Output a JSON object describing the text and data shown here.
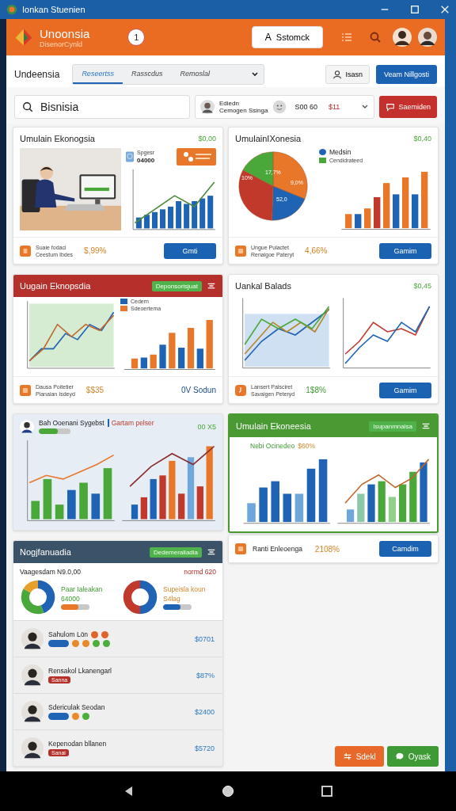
{
  "window": {
    "title": "Ionkan Stuenien"
  },
  "header": {
    "brand": "Unoonsia",
    "subtitle": "DisenorCynld",
    "badge": "1",
    "action": {
      "icon_text": "A",
      "label": "Sstomck"
    }
  },
  "nav": {
    "label": "Undeensia",
    "tabs": [
      {
        "label": "Reseertss",
        "selected": true
      },
      {
        "label": "Rasscdus",
        "selected": false
      },
      {
        "label": "Remoslal",
        "selected": false
      }
    ],
    "user_button": "Isasn",
    "primary_button": "Veam Nillgosti"
  },
  "search": {
    "value": "Bisnisia"
  },
  "account": {
    "name": "Ediedn",
    "subtitle": "Cemogen Ssinga",
    "amount": "S00 60",
    "change": "$11"
  },
  "alert_button": "Saemiden",
  "card_photo": {
    "title": "Umulain Ekonogsia",
    "value": "$0,00",
    "stat_label": "Spgesr",
    "stat_value": "04000",
    "footer_line1": "Suaie fodaci",
    "footer_line2": "Ceestum Ibdes",
    "footer_value": "$,99%",
    "button": "Gmti"
  },
  "card_pie": {
    "title": "UmulainIXonesia",
    "value": "$0,40",
    "slice_labels": [
      "17,7%",
      "10%",
      "9,0%",
      "52,0"
    ],
    "legend": [
      "Medsin",
      "Cendidrateed"
    ],
    "footer_line1": "Ungue Pulactet",
    "footer_line2": "Renaigoe Pateryt",
    "footer_value": "4,66%",
    "button": "Gamim"
  },
  "card_trend": {
    "title": "Uugain Eknopsdia",
    "badge": "Deponsorisjuat",
    "legend": [
      "Cedern",
      "Sdeoertema"
    ],
    "footer_line1": "Dausa Poitetier",
    "footer_line2": "Pianaian Isdeyd",
    "footer_value": "$$35",
    "link": "0V Sodun"
  },
  "card_balance": {
    "title": "Uankal Balads",
    "value": "$0,45",
    "footer_line1": "Lansert Palsciret",
    "footer_line2": "Savaigen Peteryd",
    "footer_value": "1$8%",
    "button": "Gamim"
  },
  "card_combo": {
    "name": "Bah Ooenani Sygebst",
    "tag": "Gartam pelser",
    "value": "00 X5",
    "level": 0.6
  },
  "card_growth": {
    "title": "Umulain Ekoneesia",
    "badge": "Isupanmnalsa",
    "metric_label": "Nebi Ocinedeo",
    "metric_value": "$60%"
  },
  "growth_footer": {
    "label": "Ranti Enleoenga",
    "value": "2108%",
    "button": "Camdim"
  },
  "card_team": {
    "title": "Nogjfanuadia",
    "badge": "Dedemeraliadia",
    "left_label": "Vaagesdam N9.0,00",
    "right_label": "normd 620",
    "donuts": [
      {
        "label": "Paar Ialeakan",
        "value": "64000",
        "level": 0.6
      },
      {
        "label": "Supeisla koun",
        "value": "S4lag",
        "level": 0.6
      }
    ],
    "people": [
      {
        "name": "Sahulom Lön",
        "name_dots": [
          {
            "color": "#e0632a"
          },
          {
            "color": "#e0632a"
          }
        ],
        "markers": [
          {
            "kind": "pill",
            "color": "#1f63b5"
          },
          {
            "kind": "dot",
            "color": "#e88a2a"
          },
          {
            "kind": "dot",
            "color": "#e88a2a"
          },
          {
            "kind": "dot",
            "color": "#4cae3a"
          },
          {
            "kind": "dot",
            "color": "#4cae3a"
          }
        ],
        "value": "$0701"
      },
      {
        "name": "Rensakol Lkanengarl",
        "tag": "Sanna",
        "value": "$87%"
      },
      {
        "name": "Sdericulak Seodan",
        "markers": [
          {
            "kind": "pill",
            "color": "#1f63b5"
          },
          {
            "kind": "dot",
            "color": "#e88a2a"
          },
          {
            "kind": "dot",
            "color": "#4cae3a"
          }
        ],
        "value": "$2400"
      },
      {
        "name": "Kepenodan bllanen",
        "tag": "Sanai",
        "value": "$5720"
      }
    ]
  },
  "fab_buttons": [
    {
      "kind": "filter",
      "label": "Sdekl"
    },
    {
      "kind": "chat",
      "label": "Oyask"
    }
  ]
}
